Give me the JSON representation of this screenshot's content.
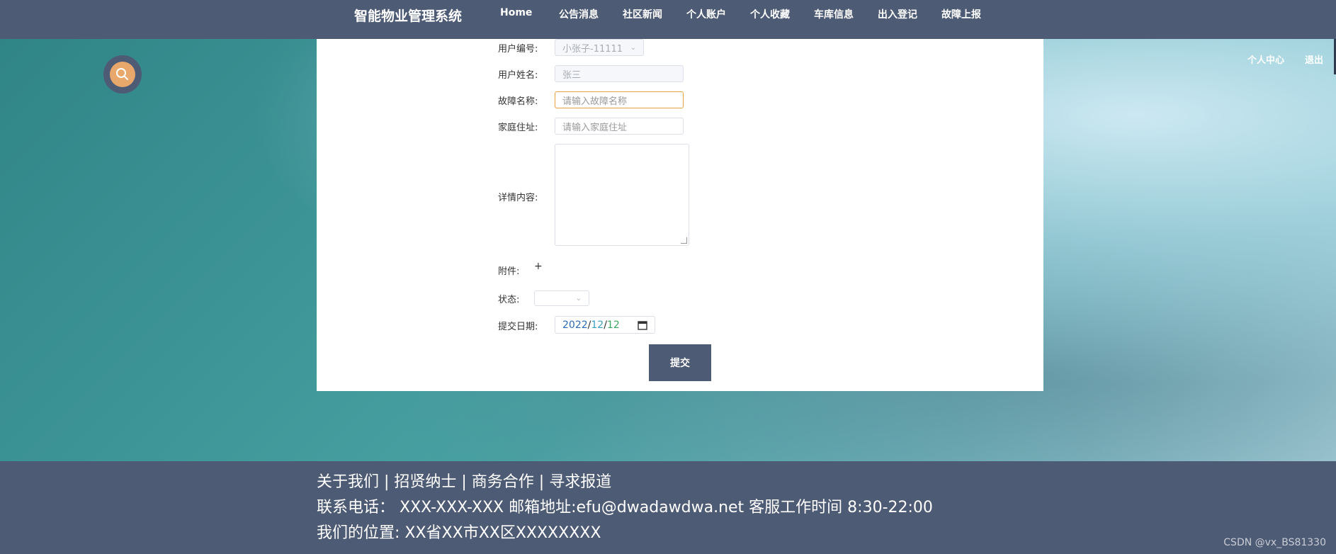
{
  "header": {
    "title": "智能物业管理系统",
    "nav": [
      "Home",
      "公告消息",
      "社区新闻",
      "个人账户",
      "个人收藏",
      "车库信息",
      "出入登记",
      "故障上报"
    ]
  },
  "top_links": {
    "center": "个人中心",
    "logout": "退出"
  },
  "search_icon": "search-icon",
  "form": {
    "user_id_label": "用户编号:",
    "user_id_value": "小张子-11111",
    "user_name_label": "用户姓名:",
    "user_name_value": "张三",
    "fault_name_label": "故障名称:",
    "fault_name_placeholder": "请输入故障名称",
    "address_label": "家庭住址:",
    "address_placeholder": "请输入家庭住址",
    "detail_label": "详情内容:",
    "attachment_label": "附件:",
    "attachment_add": "+",
    "status_label": "状态:",
    "date_label": "提交日期:",
    "date_year": "2022",
    "date_month": "12",
    "date_day": "12",
    "submit": "提交"
  },
  "footer": {
    "line1": "关于我们 | 招贤纳士 | 商务合作 | 寻求报道",
    "line2": "联系电话： XXX-XXX-XXX 邮箱地址:efu@dwadawdwa.net 客服工作时间 8:30-22:00",
    "line3": "我们的位置: XX省XX市XX区XXXXXXXX"
  },
  "watermark": "CSDN @vx_BS81330",
  "colors": {
    "nav_bg": "#4e5b74",
    "accent": "#e9a86b",
    "focus": "#e6a23c"
  }
}
